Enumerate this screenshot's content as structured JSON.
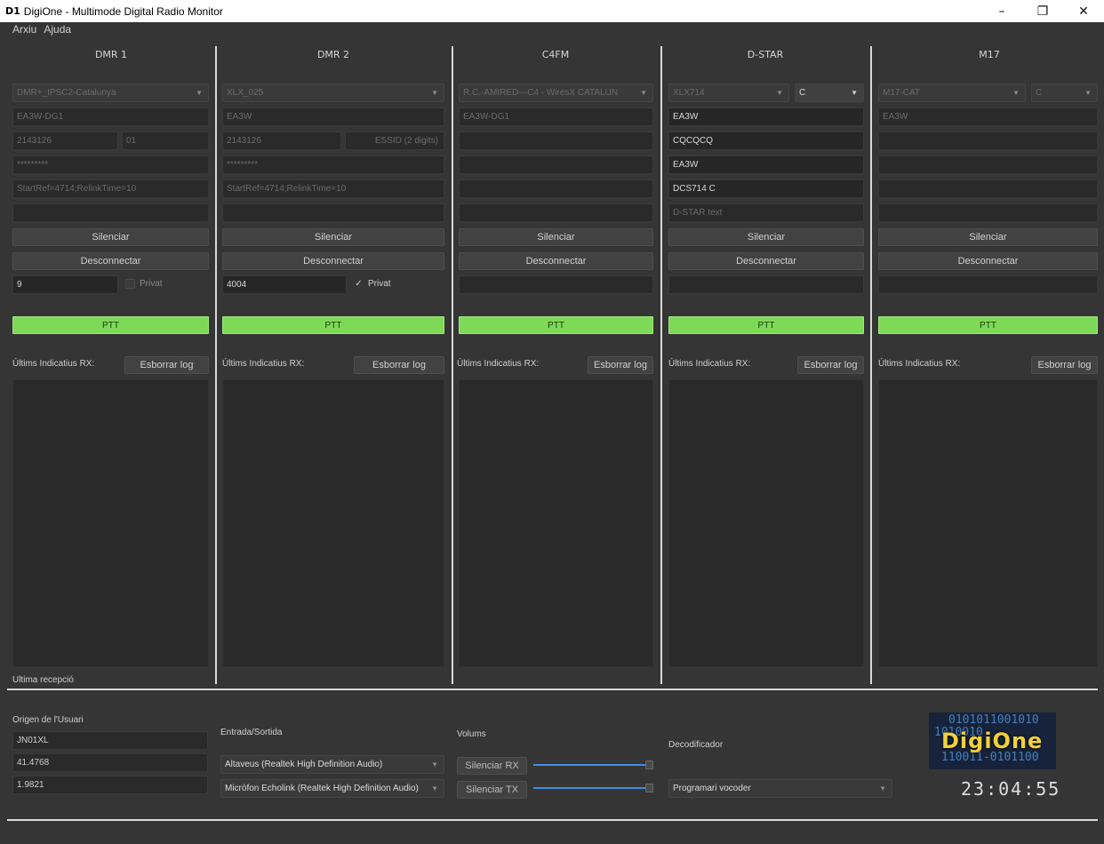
{
  "window": {
    "icon_text": "D1",
    "title": "DigiOne - Multimode Digital Radio Monitor",
    "min": "–",
    "max": "❐",
    "close": "✕"
  },
  "menu": [
    "Arxiu",
    "Ajuda"
  ],
  "columns": [
    {
      "title": "DMR 1",
      "combo": "DMR+_IPSC2-Catalunya",
      "f1": "EA3W-DG1",
      "f2a": "2143126",
      "f2b": "01",
      "f3": "*********",
      "f4": "StartRef=4714;RelinkTime=10",
      "f5": "",
      "silence": "Silenciar",
      "disconnect": "Desconnectar",
      "tg": "9",
      "private_label": "Privat",
      "private_checked": false,
      "ptt": "PTT",
      "rx_label": "Últims Indicatius RX:",
      "clear_log": "Esborrar log"
    },
    {
      "title": "DMR 2",
      "combo": "XLX_025",
      "f1": "EA3W",
      "f2a": "2143126",
      "f2b": "ESSID (2 digits)",
      "f3": "*********",
      "f4": "StartRef=4714;RelinkTime=10",
      "f5": "",
      "silence": "Silenciar",
      "disconnect": "Desconnectar",
      "tg": "4004",
      "private_label": "Privat",
      "private_checked": true,
      "ptt": "PTT",
      "rx_label": "Últims Indicatius RX:",
      "clear_log": "Esborrar log"
    },
    {
      "title": "C4FM",
      "combo": "R.C.-AMIRED---C4 - WiresX CATALUN",
      "f1": "EA3W-DG1",
      "f2": "",
      "f3": "",
      "f4": "",
      "f5": "",
      "silence": "Silenciar",
      "disconnect": "Desconnectar",
      "tg": "",
      "ptt": "PTT",
      "rx_label": "Últims Indicatius RX:",
      "clear_log": "Esborrar log"
    },
    {
      "title": "D-STAR",
      "combo": "XLX714",
      "module": "C",
      "f1": "EA3W",
      "f2": "CQCQCQ",
      "f3": "EA3W",
      "f4": "DCS714 C",
      "f5": "D-STAR text",
      "silence": "Silenciar",
      "disconnect": "Desconnectar",
      "tg": "",
      "ptt": "PTT",
      "rx_label": "Últims Indicatius RX:",
      "clear_log": "Esborrar log"
    },
    {
      "title": "M17",
      "combo": "M17-CAT",
      "module": "C",
      "f1": "EA3W",
      "f2": "",
      "f3": "",
      "f4": "",
      "f5": "",
      "silence": "Silenciar",
      "disconnect": "Desconnectar",
      "tg": "",
      "ptt": "PTT",
      "rx_label": "Últims Indicatius RX:",
      "clear_log": "Esborrar log"
    }
  ],
  "last_reception": "Ultima recepció",
  "user_origin": {
    "label": "Origen de l'Usuari",
    "callsign": "JN01XL",
    "lat": "41.4768",
    "lon": "1.9821"
  },
  "io": {
    "label": "Entrada/Sortida",
    "output": "Altaveus (Realtek High Definition Audio)",
    "input": "Micròfon Echolink (Realtek High Definition Audio)"
  },
  "volumes": {
    "label": "Volums",
    "mute_rx": "Silenciar RX",
    "mute_tx": "Silenciar TX",
    "rx_level": 1.0,
    "tx_level": 1.0
  },
  "decoder": {
    "label": "Decodificador",
    "value": "Programari vocoder"
  },
  "logo": {
    "text": "DigiOne",
    "bin1": "0101011001010",
    "bin2": "1010010",
    "bin3": "110011-0101100"
  },
  "clock": "23:04:55",
  "colors": {
    "ptt": "#7ed957",
    "slider": "#3f8fe0",
    "logo_text": "#f2d13a"
  }
}
